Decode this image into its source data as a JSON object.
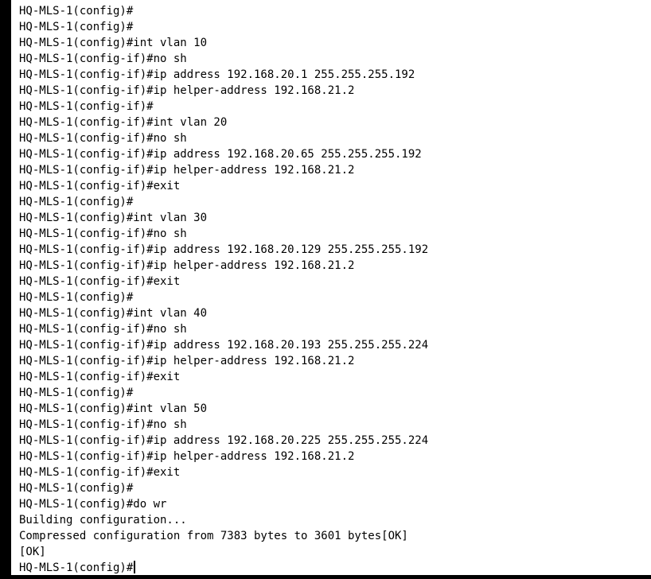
{
  "terminal": {
    "lines": [
      "HQ-MLS-1(config)#",
      "HQ-MLS-1(config)#",
      "HQ-MLS-1(config)#int vlan 10",
      "HQ-MLS-1(config-if)#no sh",
      "HQ-MLS-1(config-if)#ip address 192.168.20.1 255.255.255.192",
      "HQ-MLS-1(config-if)#ip helper-address 192.168.21.2",
      "HQ-MLS-1(config-if)#",
      "HQ-MLS-1(config-if)#int vlan 20",
      "HQ-MLS-1(config-if)#no sh",
      "HQ-MLS-1(config-if)#ip address 192.168.20.65 255.255.255.192",
      "HQ-MLS-1(config-if)#ip helper-address 192.168.21.2",
      "HQ-MLS-1(config-if)#exit",
      "HQ-MLS-1(config)#",
      "HQ-MLS-1(config)#int vlan 30",
      "HQ-MLS-1(config-if)#no sh",
      "HQ-MLS-1(config-if)#ip address 192.168.20.129 255.255.255.192",
      "HQ-MLS-1(config-if)#ip helper-address 192.168.21.2",
      "HQ-MLS-1(config-if)#exit",
      "HQ-MLS-1(config)#",
      "HQ-MLS-1(config)#int vlan 40",
      "HQ-MLS-1(config-if)#no sh",
      "HQ-MLS-1(config-if)#ip address 192.168.20.193 255.255.255.224",
      "HQ-MLS-1(config-if)#ip helper-address 192.168.21.2",
      "HQ-MLS-1(config-if)#exit",
      "HQ-MLS-1(config)#",
      "HQ-MLS-1(config)#int vlan 50",
      "HQ-MLS-1(config-if)#no sh",
      "HQ-MLS-1(config-if)#ip address 192.168.20.225 255.255.255.224",
      "HQ-MLS-1(config-if)#ip helper-address 192.168.21.2",
      "HQ-MLS-1(config-if)#exit",
      "HQ-MLS-1(config)#",
      "HQ-MLS-1(config)#do wr",
      "Building configuration...",
      "Compressed configuration from 7383 bytes to 3601 bytes[OK]",
      "[OK]"
    ],
    "prompt": "HQ-MLS-1(config)#"
  }
}
